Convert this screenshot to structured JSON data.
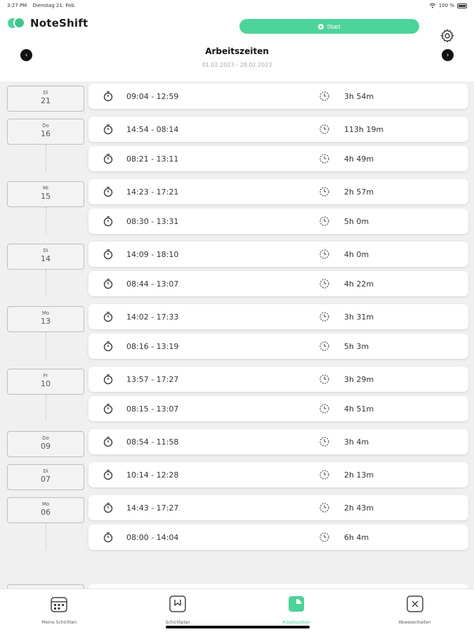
{
  "status_bar": {
    "time": "3:27 PM",
    "date": "Dienstag 21. Feb.",
    "battery": "100 %"
  },
  "header": {
    "app_name": "NoteShift",
    "start_label": "Start",
    "settings_icon": "gear-icon"
  },
  "title_bar": {
    "title": "Arbeitszeiten",
    "date_range": "01.02.2023 - 28.02.2023",
    "prev_label": "‹",
    "next_label": "›"
  },
  "days": [
    {
      "weekday": "Di",
      "day": "21",
      "entries": [
        {
          "time": "09:04 - 12:59",
          "duration": "3h 54m"
        }
      ]
    },
    {
      "weekday": "Do",
      "day": "16",
      "entries": [
        {
          "time": "14:54 - 08:14",
          "duration": "113h 19m"
        },
        {
          "time": "08:21 - 13:11",
          "duration": "4h 49m"
        }
      ]
    },
    {
      "weekday": "Mi",
      "day": "15",
      "entries": [
        {
          "time": "14:23 - 17:21",
          "duration": "2h 57m"
        },
        {
          "time": "08:30 - 13:31",
          "duration": "5h 0m"
        }
      ]
    },
    {
      "weekday": "Di",
      "day": "14",
      "entries": [
        {
          "time": "14:09 - 18:10",
          "duration": "4h 0m"
        },
        {
          "time": "08:44 - 13:07",
          "duration": "4h 22m"
        }
      ]
    },
    {
      "weekday": "Mo",
      "day": "13",
      "entries": [
        {
          "time": "14:02 - 17:33",
          "duration": "3h 31m"
        },
        {
          "time": "08:16 - 13:19",
          "duration": "5h 3m"
        }
      ]
    },
    {
      "weekday": "Fr",
      "day": "10",
      "entries": [
        {
          "time": "13:57 - 17:27",
          "duration": "3h 29m"
        },
        {
          "time": "08:15 - 13:07",
          "duration": "4h 51m"
        }
      ]
    },
    {
      "weekday": "Do",
      "day": "09",
      "entries": [
        {
          "time": "08:54 - 11:58",
          "duration": "3h 4m"
        }
      ]
    },
    {
      "weekday": "Di",
      "day": "07",
      "entries": [
        {
          "time": "10:14 - 12:28",
          "duration": "2h 13m"
        }
      ]
    },
    {
      "weekday": "Mo",
      "day": "06",
      "entries": [
        {
          "time": "14:43 - 17:27",
          "duration": "2h 43m"
        },
        {
          "time": "08:00 - 14:04",
          "duration": "6h 4m"
        }
      ]
    }
  ],
  "tabs": [
    {
      "label": "Meine Schichten",
      "icon": "calendar-icon",
      "active": false
    },
    {
      "label": "Schichtplan",
      "icon": "plan-icon",
      "active": false
    },
    {
      "label": "Arbeitszeiten",
      "icon": "worktime-icon",
      "active": true
    },
    {
      "label": "Abwesenheiten",
      "icon": "absence-icon",
      "active": false
    }
  ],
  "colors": {
    "accent": "#4cd39a",
    "background": "#f0f0f0"
  }
}
